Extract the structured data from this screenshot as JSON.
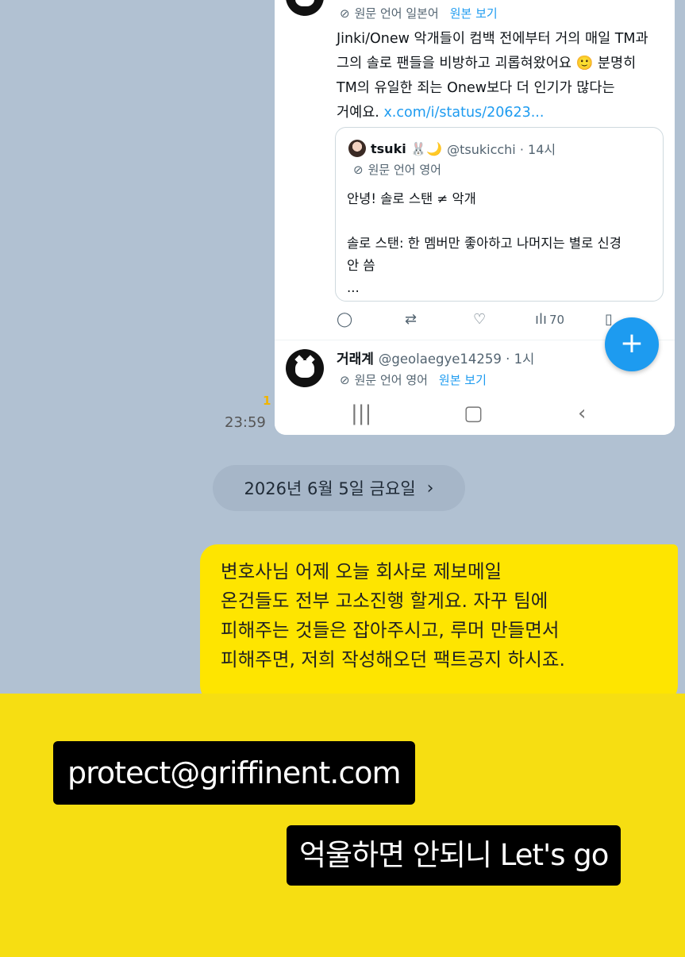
{
  "screenshot": {
    "tweet": {
      "translate_label": "원문 언어 일본어",
      "show_original": "원본 보기",
      "text_lines": [
        "Jinki/Onew 악개들이 컴백 전에부터 거의 매일 TM과",
        "그의 솔로 팬들을 비방하고 괴롭혀왔어요 🙂 분명히",
        "TM의 유일한 죄는 Onew보다 더 인기가 많다는"
      ],
      "last_line_text": "거예요.",
      "link": "x.com/i/status/20623..."
    },
    "quote": {
      "name": "tsuki 🐰🌙",
      "handle": "@tsukicchi · 14시",
      "translate_label": "원문 언어 영어",
      "body": "안녕! 솔로 스탠 ≠ 악개\n\n솔로 스탠: 한 멤버만 좋아하고 나머지는 별로 신경\n안 씀\n..."
    },
    "actions": {
      "views": "70"
    },
    "reply": {
      "name": "거래계",
      "handle": "@geolaegye14259 · 1시",
      "translate_label": "원문 언어 영어",
      "show_original": "원본 보기"
    },
    "fab_label": "+"
  },
  "chat": {
    "read_count": "1",
    "time": "23:59",
    "date_divider": "2026년 6월 5일 금요일",
    "message_lines": [
      "변호사님 어제 오늘 회사로 제보메일",
      "온건들도 전부 고소진행 할게요. 자꾸 팀에",
      "피해주는 것들은 잡아주시고, 루머 만들면서",
      "피해주면, 저희 작성해오던 팩트공지 하시죠."
    ]
  },
  "story": {
    "email": "protect@griffinent.com",
    "slogan": "억울하면 안되니 Let's go"
  },
  "colors": {
    "chat_bg": "#b1c1d2",
    "bubble": "#fee500",
    "story_overlay": "#f6de12",
    "twitter_blue": "#1d9bf0"
  }
}
